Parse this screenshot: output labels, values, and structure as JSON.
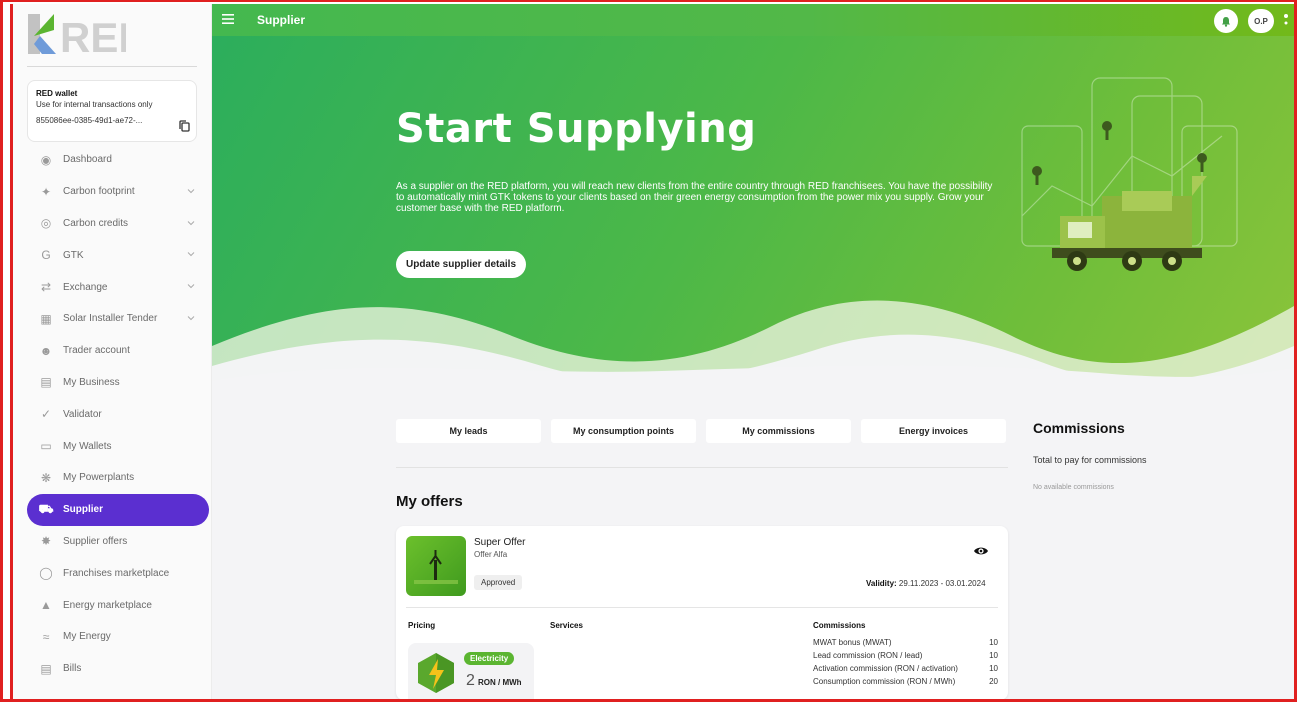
{
  "brand": {
    "logo_text": "RED"
  },
  "wallet": {
    "title": "RED wallet",
    "subtitle": "Use for internal transactions only",
    "address": "855086ee-0385-49d1-ae72-..."
  },
  "sidebar": {
    "items": [
      {
        "label": "Dashboard",
        "icon": "dashboard-icon",
        "expandable": false
      },
      {
        "label": "Carbon footprint",
        "icon": "footprint-icon",
        "expandable": true
      },
      {
        "label": "Carbon credits",
        "icon": "carbon-credits-icon",
        "expandable": true
      },
      {
        "label": "GTK",
        "icon": "gtk-icon",
        "expandable": true
      },
      {
        "label": "Exchange",
        "icon": "exchange-icon",
        "expandable": true
      },
      {
        "label": "Solar Installer Tender",
        "icon": "solar-panel-icon",
        "expandable": true
      },
      {
        "label": "Trader account",
        "icon": "trader-icon",
        "expandable": false
      },
      {
        "label": "My Business",
        "icon": "business-icon",
        "expandable": false
      },
      {
        "label": "Validator",
        "icon": "check-icon",
        "expandable": false
      },
      {
        "label": "My Wallets",
        "icon": "wallet-icon",
        "expandable": false
      },
      {
        "label": "My Powerplants",
        "icon": "powerplant-icon",
        "expandable": false
      },
      {
        "label": "Supplier",
        "icon": "truck-icon",
        "expandable": false,
        "active": true
      },
      {
        "label": "Supplier offers",
        "icon": "offers-icon",
        "expandable": false
      },
      {
        "label": "Franchises marketplace",
        "icon": "globe-icon",
        "expandable": false
      },
      {
        "label": "Energy marketplace",
        "icon": "basket-icon",
        "expandable": false
      },
      {
        "label": "My Energy",
        "icon": "energy-icon",
        "expandable": false
      },
      {
        "label": "Bills",
        "icon": "bill-icon",
        "expandable": false
      }
    ]
  },
  "topbar": {
    "title": "Supplier",
    "avatar_initials": "O.P"
  },
  "hero": {
    "title": "Start Supplying",
    "text": "As a supplier on the RED platform, you will reach new clients from the entire country through RED franchisees. You have the possibility to automatically mint GTK tokens to your clients based on their green energy consumption from the power mix you supply. Grow your customer base with the RED platform.",
    "button": "Update supplier details"
  },
  "tabs": [
    "My leads",
    "My consumption points",
    "My commissions",
    "Energy invoices"
  ],
  "offers": {
    "title": "My offers",
    "card": {
      "name": "Super Offer",
      "subtitle": "Offer Alfa",
      "status": "Approved",
      "validity_label": "Validity:",
      "validity_value": "29.11.2023 - 03.01.2024",
      "pricing_label": "Pricing",
      "services_label": "Services",
      "commissions_label": "Commissions",
      "energy_type": "Electricity",
      "price": "2",
      "price_unit": "RON / MWh",
      "commissions": [
        {
          "label": "MWAT bonus (MWAT)",
          "value": "10"
        },
        {
          "label": "Lead commission (RON / lead)",
          "value": "10"
        },
        {
          "label": "Activation commission (RON / activation)",
          "value": "10"
        },
        {
          "label": "Consumption commission (RON / MWh)",
          "value": "20"
        }
      ]
    }
  },
  "commissions_panel": {
    "title": "Commissions",
    "subtitle": "Total to pay for commissions",
    "empty": "No available commissions"
  },
  "colors": {
    "accent": "#5b2fd0",
    "green": "#4cb848",
    "frame": "#e02020"
  }
}
